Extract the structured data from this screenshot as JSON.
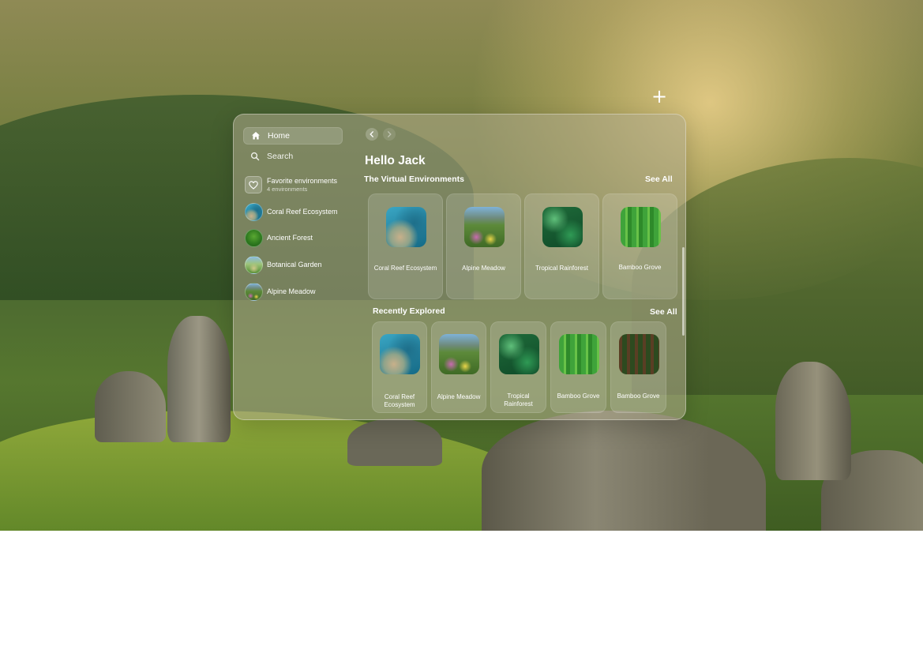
{
  "toolbar": {
    "add_icon": "plus-icon",
    "add_label": "+"
  },
  "sidebar": {
    "home": {
      "label": "Home",
      "icon": "home-icon"
    },
    "search": {
      "label": "Search",
      "icon": "search-icon"
    },
    "favorites": {
      "title": "Favorite environments",
      "subtitle": "4 environments",
      "icon": "heart-icon"
    },
    "environments": [
      {
        "label": "Coral Reef Ecosystem"
      },
      {
        "label": "Ancient Forest"
      },
      {
        "label": "Botanical Garden"
      },
      {
        "label": "Alpine Meadow"
      }
    ]
  },
  "main": {
    "back_icon": "chevron-left-icon",
    "forward_icon": "chevron-right-icon",
    "greeting": "Hello Jack",
    "virtual": {
      "title": "The Virtual Environments",
      "see_all": "See All",
      "cards": [
        {
          "label": "Coral Reef Ecosystem"
        },
        {
          "label": "Alpine Meadow"
        },
        {
          "label": "Tropical Rainforest"
        },
        {
          "label": "Bamboo Grove"
        }
      ]
    },
    "recent": {
      "title": "Recently Explored",
      "see_all": "See All",
      "cards": [
        {
          "label": "Coral Reef Ecosystem"
        },
        {
          "label": "Alpine Meadow"
        },
        {
          "label": "Tropical Rainforest"
        },
        {
          "label": "Bamboo Grove"
        },
        {
          "label": "Bamboo Grove"
        }
      ]
    }
  },
  "colors": {
    "text": "#ffffff",
    "glass": "#afaa8c"
  }
}
